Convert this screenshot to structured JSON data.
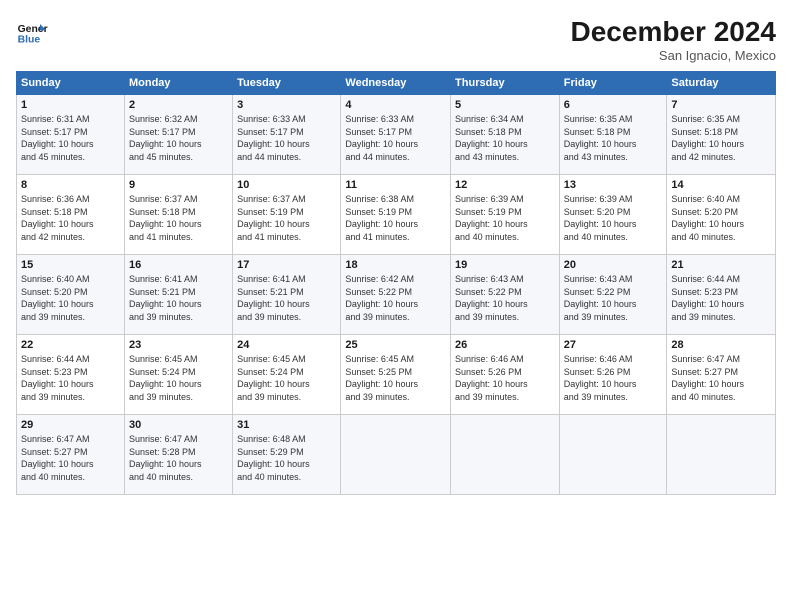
{
  "header": {
    "logo_line1": "General",
    "logo_line2": "Blue",
    "month": "December 2024",
    "location": "San Ignacio, Mexico"
  },
  "days_of_week": [
    "Sunday",
    "Monday",
    "Tuesday",
    "Wednesday",
    "Thursday",
    "Friday",
    "Saturday"
  ],
  "weeks": [
    [
      {
        "day": "1",
        "info": "Sunrise: 6:31 AM\nSunset: 5:17 PM\nDaylight: 10 hours\nand 45 minutes."
      },
      {
        "day": "2",
        "info": "Sunrise: 6:32 AM\nSunset: 5:17 PM\nDaylight: 10 hours\nand 45 minutes."
      },
      {
        "day": "3",
        "info": "Sunrise: 6:33 AM\nSunset: 5:17 PM\nDaylight: 10 hours\nand 44 minutes."
      },
      {
        "day": "4",
        "info": "Sunrise: 6:33 AM\nSunset: 5:17 PM\nDaylight: 10 hours\nand 44 minutes."
      },
      {
        "day": "5",
        "info": "Sunrise: 6:34 AM\nSunset: 5:18 PM\nDaylight: 10 hours\nand 43 minutes."
      },
      {
        "day": "6",
        "info": "Sunrise: 6:35 AM\nSunset: 5:18 PM\nDaylight: 10 hours\nand 43 minutes."
      },
      {
        "day": "7",
        "info": "Sunrise: 6:35 AM\nSunset: 5:18 PM\nDaylight: 10 hours\nand 42 minutes."
      }
    ],
    [
      {
        "day": "8",
        "info": "Sunrise: 6:36 AM\nSunset: 5:18 PM\nDaylight: 10 hours\nand 42 minutes."
      },
      {
        "day": "9",
        "info": "Sunrise: 6:37 AM\nSunset: 5:18 PM\nDaylight: 10 hours\nand 41 minutes."
      },
      {
        "day": "10",
        "info": "Sunrise: 6:37 AM\nSunset: 5:19 PM\nDaylight: 10 hours\nand 41 minutes."
      },
      {
        "day": "11",
        "info": "Sunrise: 6:38 AM\nSunset: 5:19 PM\nDaylight: 10 hours\nand 41 minutes."
      },
      {
        "day": "12",
        "info": "Sunrise: 6:39 AM\nSunset: 5:19 PM\nDaylight: 10 hours\nand 40 minutes."
      },
      {
        "day": "13",
        "info": "Sunrise: 6:39 AM\nSunset: 5:20 PM\nDaylight: 10 hours\nand 40 minutes."
      },
      {
        "day": "14",
        "info": "Sunrise: 6:40 AM\nSunset: 5:20 PM\nDaylight: 10 hours\nand 40 minutes."
      }
    ],
    [
      {
        "day": "15",
        "info": "Sunrise: 6:40 AM\nSunset: 5:20 PM\nDaylight: 10 hours\nand 39 minutes."
      },
      {
        "day": "16",
        "info": "Sunrise: 6:41 AM\nSunset: 5:21 PM\nDaylight: 10 hours\nand 39 minutes."
      },
      {
        "day": "17",
        "info": "Sunrise: 6:41 AM\nSunset: 5:21 PM\nDaylight: 10 hours\nand 39 minutes."
      },
      {
        "day": "18",
        "info": "Sunrise: 6:42 AM\nSunset: 5:22 PM\nDaylight: 10 hours\nand 39 minutes."
      },
      {
        "day": "19",
        "info": "Sunrise: 6:43 AM\nSunset: 5:22 PM\nDaylight: 10 hours\nand 39 minutes."
      },
      {
        "day": "20",
        "info": "Sunrise: 6:43 AM\nSunset: 5:22 PM\nDaylight: 10 hours\nand 39 minutes."
      },
      {
        "day": "21",
        "info": "Sunrise: 6:44 AM\nSunset: 5:23 PM\nDaylight: 10 hours\nand 39 minutes."
      }
    ],
    [
      {
        "day": "22",
        "info": "Sunrise: 6:44 AM\nSunset: 5:23 PM\nDaylight: 10 hours\nand 39 minutes."
      },
      {
        "day": "23",
        "info": "Sunrise: 6:45 AM\nSunset: 5:24 PM\nDaylight: 10 hours\nand 39 minutes."
      },
      {
        "day": "24",
        "info": "Sunrise: 6:45 AM\nSunset: 5:24 PM\nDaylight: 10 hours\nand 39 minutes."
      },
      {
        "day": "25",
        "info": "Sunrise: 6:45 AM\nSunset: 5:25 PM\nDaylight: 10 hours\nand 39 minutes."
      },
      {
        "day": "26",
        "info": "Sunrise: 6:46 AM\nSunset: 5:26 PM\nDaylight: 10 hours\nand 39 minutes."
      },
      {
        "day": "27",
        "info": "Sunrise: 6:46 AM\nSunset: 5:26 PM\nDaylight: 10 hours\nand 39 minutes."
      },
      {
        "day": "28",
        "info": "Sunrise: 6:47 AM\nSunset: 5:27 PM\nDaylight: 10 hours\nand 40 minutes."
      }
    ],
    [
      {
        "day": "29",
        "info": "Sunrise: 6:47 AM\nSunset: 5:27 PM\nDaylight: 10 hours\nand 40 minutes."
      },
      {
        "day": "30",
        "info": "Sunrise: 6:47 AM\nSunset: 5:28 PM\nDaylight: 10 hours\nand 40 minutes."
      },
      {
        "day": "31",
        "info": "Sunrise: 6:48 AM\nSunset: 5:29 PM\nDaylight: 10 hours\nand 40 minutes."
      },
      {
        "day": "",
        "info": ""
      },
      {
        "day": "",
        "info": ""
      },
      {
        "day": "",
        "info": ""
      },
      {
        "day": "",
        "info": ""
      }
    ]
  ]
}
